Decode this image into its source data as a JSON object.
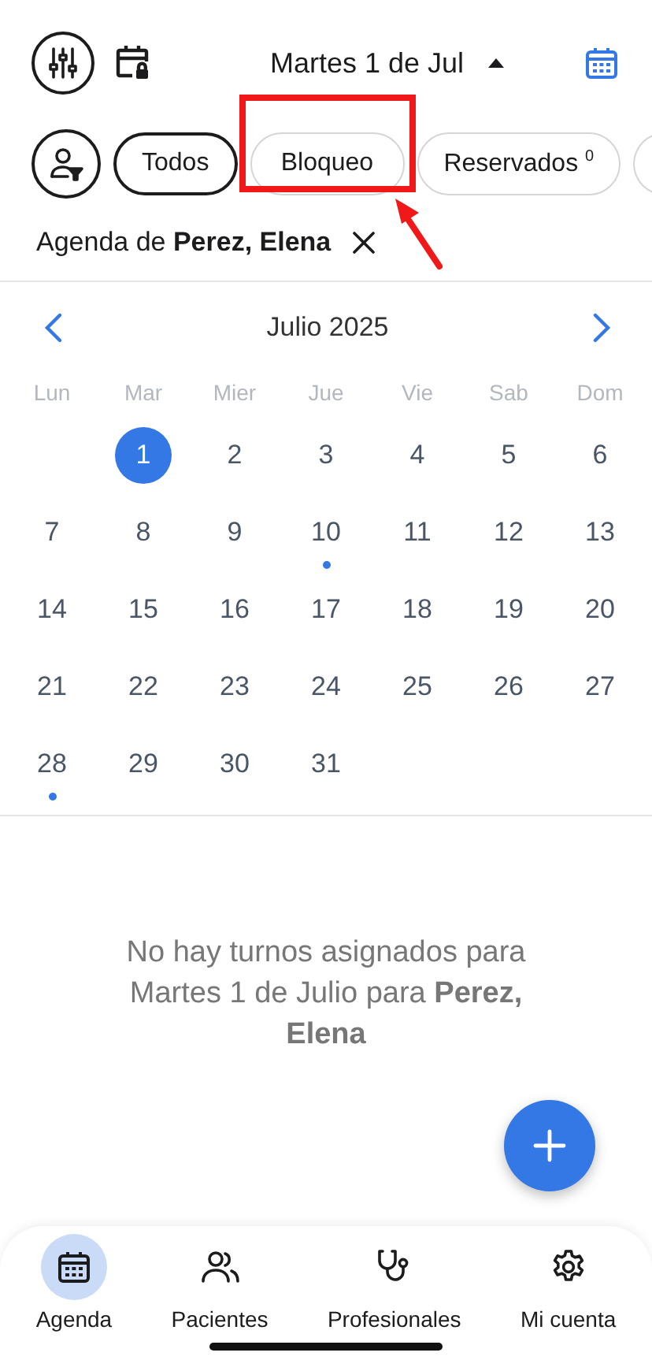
{
  "header": {
    "date": "Martes 1 de Jul",
    "expanded": true
  },
  "chips": [
    {
      "label": "Todos",
      "selected": true
    },
    {
      "label": "Bloqueo",
      "selected": false
    },
    {
      "label": "Reservados $^{0}$",
      "selected": false
    }
  ],
  "agenda_filter": {
    "text": "Agenda de **Perez, Elena**"
  },
  "calendar": {
    "month": "Julio 2025",
    "weekdays": [
      "Lun",
      "Mar",
      "Mier",
      "Jue",
      "Vie",
      "Sab",
      "Dom"
    ],
    "weeks": [
      [
        {
          "day": "1",
          "selected": true,
          "has_events": false
        },
        {
          "day": "2",
          "selected": false,
          "has_events": false
        },
        {
          "day": "3",
          "selected": false,
          "has_events": false
        },
        {
          "day": "4",
          "selected": false,
          "has_events": false
        },
        {
          "day": "5",
          "selected": false,
          "has_events": false
        },
        {
          "day": "6",
          "selected": false,
          "has_events": false
        }
      ],
      [
        {
          "day": "7",
          "selected": false,
          "has_events": false
        },
        {
          "day": "8",
          "selected": false,
          "has_events": false
        },
        {
          "day": "9",
          "selected": false,
          "has_events": false
        },
        {
          "day": "10",
          "selected": false,
          "has_events": true
        },
        {
          "day": "11",
          "selected": false,
          "has_events": false
        },
        {
          "day": "12",
          "selected": false,
          "has_events": false
        },
        {
          "day": "13",
          "selected": false,
          "has_events": false
        }
      ],
      [
        {
          "day": "14",
          "selected": false,
          "has_events": false
        },
        {
          "day": "15",
          "selected": false,
          "has_events": false
        },
        {
          "day": "16",
          "selected": false,
          "has_events": false
        },
        {
          "day": "17",
          "selected": false,
          "has_events": false
        },
        {
          "day": "18",
          "selected": false,
          "has_events": false
        },
        {
          "day": "19",
          "selected": false,
          "has_events": false
        },
        {
          "day": "20",
          "selected": false,
          "has_events": false
        }
      ],
      [
        {
          "day": "21",
          "selected": false,
          "has_events": false
        },
        {
          "day": "22",
          "selected": false,
          "has_events": false
        },
        {
          "day": "23",
          "selected": false,
          "has_events": false
        },
        {
          "day": "24",
          "selected": false,
          "has_events": false
        },
        {
          "day": "25",
          "selected": false,
          "has_events": false
        },
        {
          "day": "26",
          "selected": false,
          "has_events": false
        },
        {
          "day": "27",
          "selected": false,
          "has_events": false
        }
      ],
      [
        {
          "day": "28",
          "selected": false,
          "has_events": true
        },
        {
          "day": "29",
          "selected": false,
          "has_events": false
        },
        {
          "day": "30",
          "selected": false,
          "has_events": false
        },
        {
          "day": "31",
          "selected": false,
          "has_events": false
        }
      ]
    ]
  },
  "empty_message": "No hay turnos asignados para Martes 1 de Julio para **Perez, Elena**",
  "nav": [
    {
      "label": "Agenda",
      "selected": true,
      "kind": "calendar"
    },
    {
      "label": "Pacientes",
      "selected": false,
      "kind": "people"
    },
    {
      "label": "Profesionales",
      "selected": false,
      "kind": "stethoscope"
    },
    {
      "label": "Mi cuenta",
      "selected": false,
      "kind": "settings"
    }
  ]
}
